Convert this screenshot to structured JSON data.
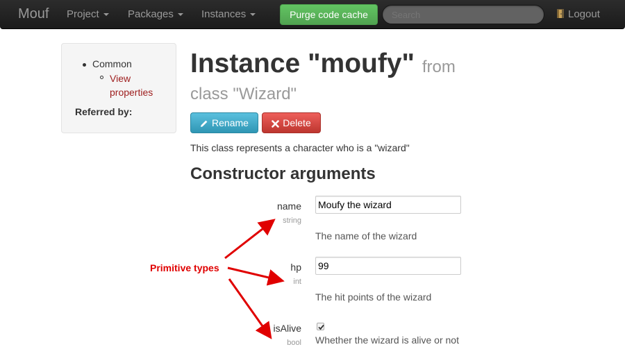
{
  "navbar": {
    "brand": "Mouf",
    "menus": [
      {
        "label": "Project"
      },
      {
        "label": "Packages"
      },
      {
        "label": "Instances"
      }
    ],
    "purge_label": "Purge code cache",
    "search_placeholder": "Search",
    "logout_label": "Logout",
    "purge_color": "#5bb75b"
  },
  "sidebar": {
    "section": "Common",
    "link": "View properties",
    "referred_by": "Referred by:"
  },
  "main": {
    "title": "Instance \"moufy\"",
    "from": "from",
    "class_label": "class \"Wizard\"",
    "rename_label": "Rename",
    "delete_label": "Delete",
    "description": "This class represents a character who is a \"wizard\"",
    "section_title": "Constructor arguments",
    "args": [
      {
        "name": "name",
        "type": "string",
        "value": "Moufy the wizard",
        "help": "The name of the wizard"
      },
      {
        "name": "hp",
        "type": "int",
        "value": "99",
        "help": "The hit points of the wizard"
      },
      {
        "name": "isAlive",
        "type": "bool",
        "checked": true,
        "help": "Whether the wizard is alive or not"
      }
    ]
  },
  "annotation": {
    "label": "Primitive types",
    "color": "#e00000"
  }
}
